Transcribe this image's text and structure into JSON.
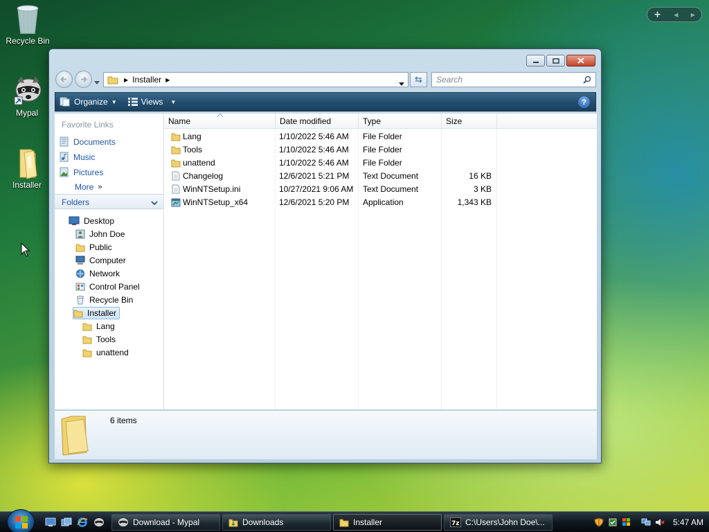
{
  "desktop": {
    "icons": [
      {
        "label": "Recycle Bin"
      },
      {
        "label": "Mypal"
      },
      {
        "label": "Installer"
      }
    ]
  },
  "sidebar_controls": {
    "add": "+",
    "prev": "◀",
    "next": "▶"
  },
  "window": {
    "address": {
      "folder": "Installer"
    },
    "search": {
      "placeholder": "Search"
    },
    "toolbar": {
      "organize": "Organize",
      "views": "Views",
      "help": "?"
    },
    "favorite_links": {
      "title": "Favorite Links",
      "items": [
        "Documents",
        "Music",
        "Pictures"
      ],
      "more": "More"
    },
    "folders": {
      "title": "Folders",
      "tree": [
        "Desktop",
        "John Doe",
        "Public",
        "Computer",
        "Network",
        "Control Panel",
        "Recycle Bin",
        "Installer",
        "Lang",
        "Tools",
        "unattend"
      ]
    },
    "columns": {
      "name": "Name",
      "date": "Date modified",
      "type": "Type",
      "size": "Size"
    },
    "files": [
      {
        "name": "Lang",
        "date": "1/10/2022 5:46 AM",
        "type": "File Folder",
        "size": "",
        "icon": "folder-icon"
      },
      {
        "name": "Tools",
        "date": "1/10/2022 5:46 AM",
        "type": "File Folder",
        "size": "",
        "icon": "folder-icon"
      },
      {
        "name": "unattend",
        "date": "1/10/2022 5:46 AM",
        "type": "File Folder",
        "size": "",
        "icon": "folder-icon"
      },
      {
        "name": "Changelog",
        "date": "12/6/2021 5:21 PM",
        "type": "Text Document",
        "size": "16 KB",
        "icon": "text-document-icon"
      },
      {
        "name": "WinNTSetup.ini",
        "date": "10/27/2021 9:06 AM",
        "type": "Text Document",
        "size": "3 KB",
        "icon": "text-document-icon"
      },
      {
        "name": "WinNTSetup_x64",
        "date": "12/6/2021 5:20 PM",
        "type": "Application",
        "size": "1,343 KB",
        "icon": "application-icon"
      }
    ],
    "details": {
      "count": "6 items"
    }
  },
  "taskbar": {
    "buttons": [
      {
        "label": "Download - Mypal"
      },
      {
        "label": "Downloads"
      },
      {
        "label": "Installer"
      },
      {
        "label": "C:\\Users\\John Doe\\..."
      }
    ],
    "clock": "5:47 AM"
  }
}
